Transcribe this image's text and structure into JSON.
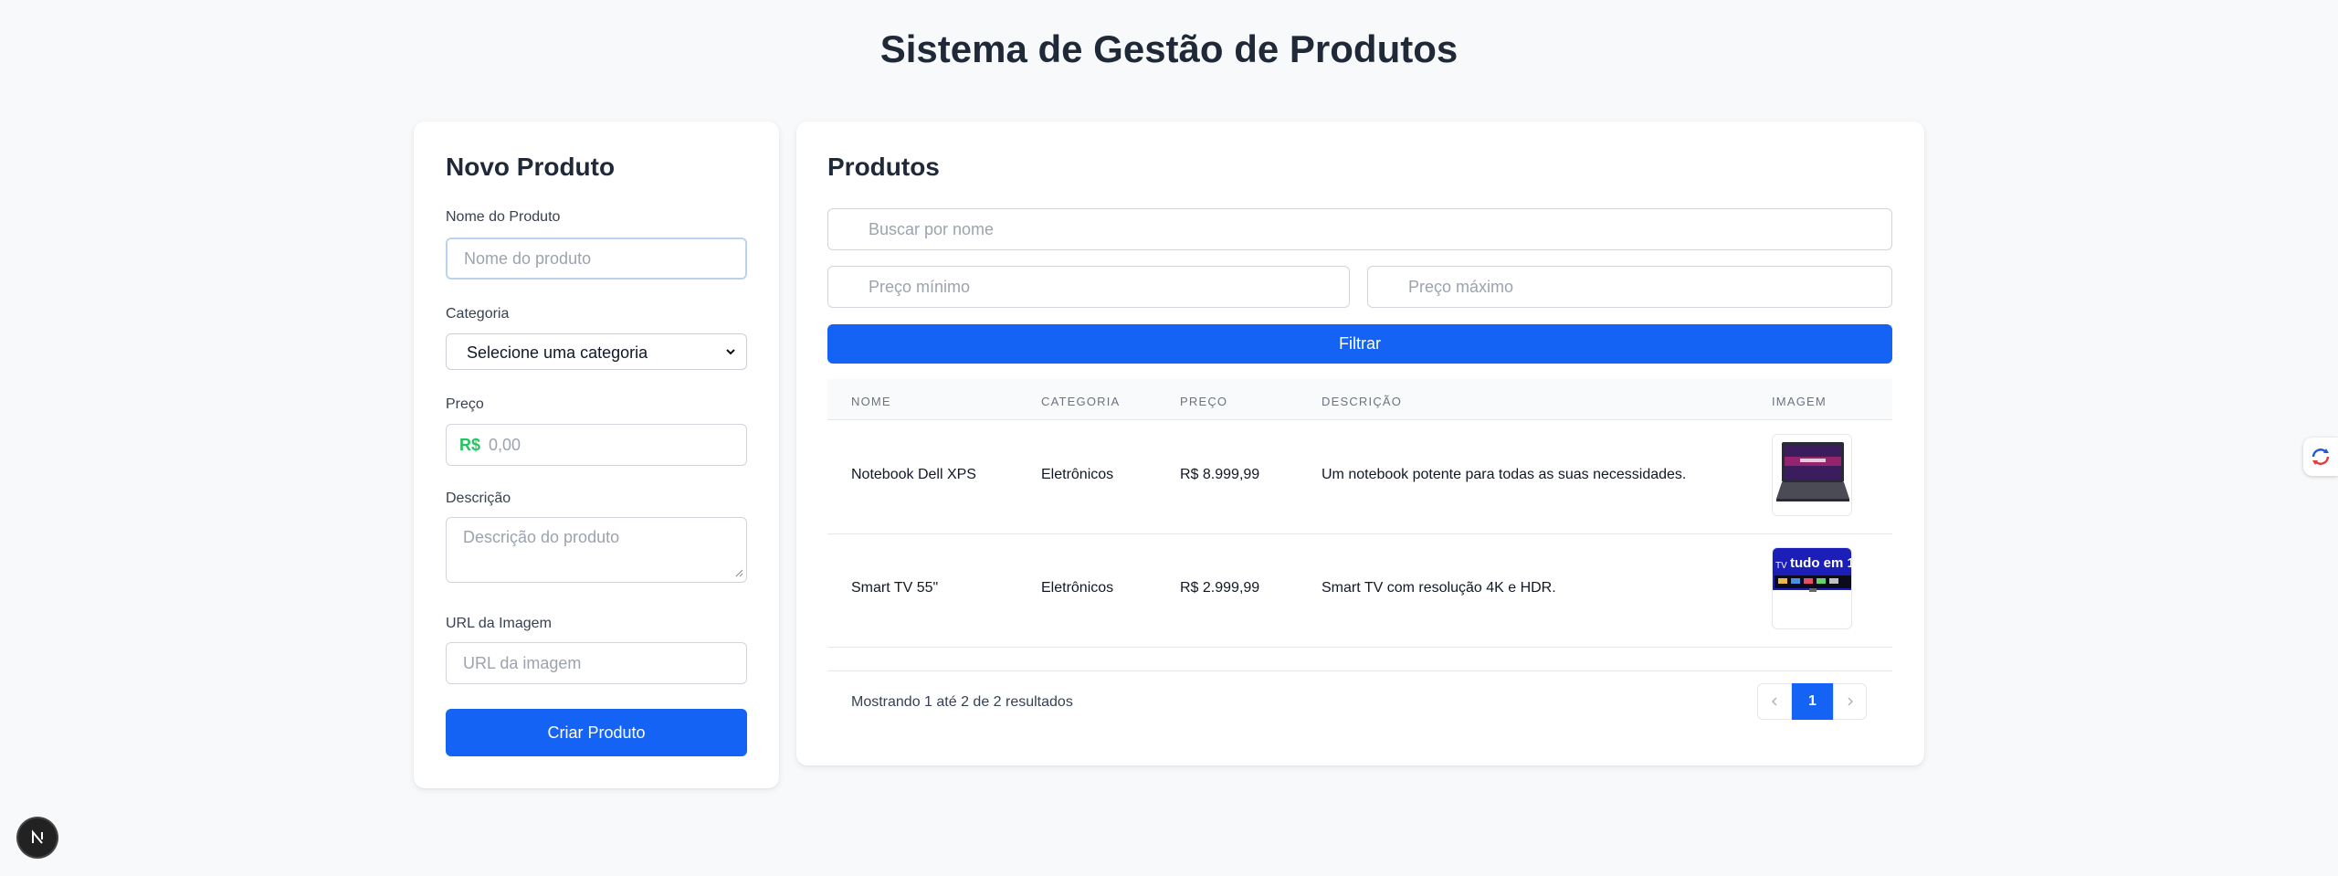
{
  "page": {
    "title": "Sistema de Gestão de Produtos"
  },
  "form": {
    "title": "Novo Produto",
    "name_label": "Nome do Produto",
    "name_placeholder": "Nome do produto",
    "category_label": "Categoria",
    "category_selected": "Selecione uma categoria",
    "price_label": "Preço",
    "currency_symbol": "R$",
    "price_placeholder": "0,00",
    "description_label": "Descrição",
    "description_placeholder": "Descrição do produto",
    "image_label": "URL da Imagem",
    "image_placeholder": "URL da imagem",
    "submit_label": "Criar Produto"
  },
  "products": {
    "title": "Produtos",
    "search_placeholder": "Buscar por nome",
    "min_price_placeholder": "Preço mínimo",
    "max_price_placeholder": "Preço máximo",
    "filter_label": "Filtrar",
    "columns": [
      "Nome",
      "Categoria",
      "Preço",
      "Descrição",
      "Imagem"
    ],
    "rows": [
      {
        "name": "Notebook Dell XPS",
        "category": "Eletrônicos",
        "price": "R$ 8.999,99",
        "description": "Um notebook potente para todas as suas necessidades.",
        "image": "laptop-image"
      },
      {
        "name": "Smart TV 55\"",
        "category": "Eletrônicos",
        "price": "R$ 2.999,99",
        "description": "Smart TV com resolução 4K e HDR.",
        "image": "tv-image"
      }
    ],
    "tv_banner_prefix": "TV",
    "tv_banner_text": "tudo em 1",
    "result_summary": "Mostrando 1 até 2 de 2 resultados",
    "pagination": {
      "current_page": "1"
    }
  },
  "colors": {
    "primary": "#1463f5",
    "currency": "#22c55e",
    "background": "#f7f9fb"
  }
}
